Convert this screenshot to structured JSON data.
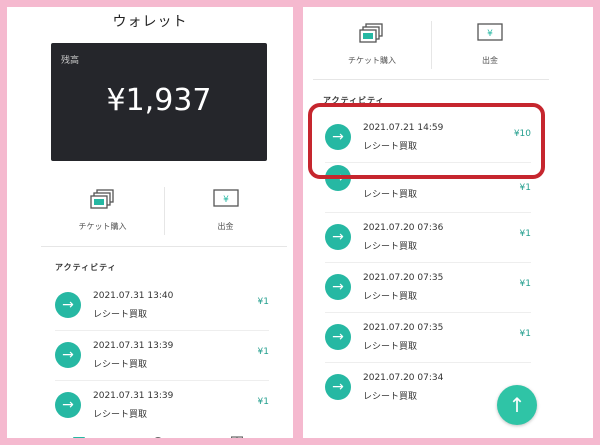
{
  "left": {
    "title": "ウォレット",
    "balance": {
      "label": "残高",
      "amount": "¥1,937"
    },
    "actions": [
      {
        "label": "チケット購入",
        "icon": "ticket-icon"
      },
      {
        "label": "出金",
        "icon": "yen-card-icon"
      }
    ],
    "activity_title": "アクティビティ",
    "transactions": [
      {
        "date": "2021.07.31 13:40",
        "description": "レシート買取",
        "amount": "¥1"
      },
      {
        "date": "2021.07.31 13:39",
        "description": "レシート買取",
        "amount": "¥1"
      },
      {
        "date": "2021.07.31 13:39",
        "description": "レシート買取",
        "amount": "¥1"
      }
    ],
    "bottom_nav": [
      "wallet-icon",
      "home-icon",
      "grid-icon"
    ]
  },
  "right": {
    "actions": [
      {
        "label": "チケット購入",
        "icon": "ticket-icon"
      },
      {
        "label": "出金",
        "icon": "yen-card-icon"
      }
    ],
    "activity_title": "アクティビティ",
    "transactions": [
      {
        "date": "2021.07.21 14:59",
        "description": "レシート買取",
        "amount": "¥10"
      },
      {
        "date": "",
        "description": "レシート買取",
        "amount": "¥1"
      },
      {
        "date": "2021.07.20 07:36",
        "description": "レシート買取",
        "amount": "¥1"
      },
      {
        "date": "2021.07.20 07:35",
        "description": "レシート買取",
        "amount": "¥1"
      },
      {
        "date": "2021.07.20 07:35",
        "description": "レシート買取",
        "amount": "¥1"
      },
      {
        "date": "2021.07.20 07:34",
        "description": "レシート買取",
        "amount": "¥1"
      }
    ],
    "fab_icon": "arrow-up-icon"
  },
  "colors": {
    "accent": "#26b8a3",
    "highlight": "#c6262e",
    "card": "#25262b",
    "frame": "#f5b9cf"
  }
}
